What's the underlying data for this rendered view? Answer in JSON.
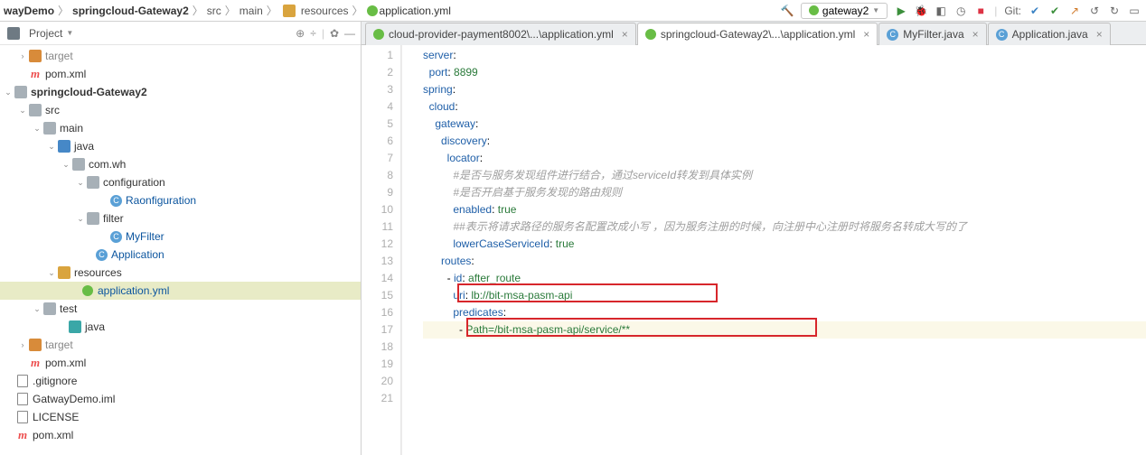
{
  "breadcrumbs": {
    "p0": "wayDemo",
    "p1": "springcloud-Gateway2",
    "p2": "src",
    "p3": "main",
    "p4": "resources",
    "p5": "application.yml"
  },
  "runConfig": "gateway2",
  "gitLabel": "Git:",
  "sidebar": {
    "title": "Project",
    "nodes": [
      {
        "pad": 20,
        "arrow": ">",
        "ico": "folder orange",
        "label": "target",
        "dim": true
      },
      {
        "pad": 20,
        "arrow": "",
        "ico": "m",
        "label": "pom.xml"
      },
      {
        "pad": 4,
        "arrow": "v",
        "ico": "folder",
        "label": "springcloud-Gateway2",
        "bold": true
      },
      {
        "pad": 20,
        "arrow": "v",
        "ico": "folder",
        "label": "src"
      },
      {
        "pad": 36,
        "arrow": "v",
        "ico": "folder",
        "label": "main"
      },
      {
        "pad": 52,
        "arrow": "v",
        "ico": "folder blue",
        "label": "java"
      },
      {
        "pad": 68,
        "arrow": "v",
        "ico": "folder",
        "label": "com.wh"
      },
      {
        "pad": 84,
        "arrow": "v",
        "ico": "folder",
        "label": "configuration"
      },
      {
        "pad": 110,
        "arrow": "",
        "ico": "c",
        "label": "Raonfiguration",
        "blue": true
      },
      {
        "pad": 84,
        "arrow": "v",
        "ico": "folder",
        "label": "filter"
      },
      {
        "pad": 110,
        "arrow": "",
        "ico": "c",
        "label": "MyFilter",
        "blue": true
      },
      {
        "pad": 94,
        "arrow": "",
        "ico": "c",
        "label": "Application",
        "blue": true
      },
      {
        "pad": 52,
        "arrow": "v",
        "ico": "folder yellow",
        "label": "resources"
      },
      {
        "pad": 78,
        "arrow": "",
        "ico": "spring",
        "label": "application.yml",
        "blue": true,
        "hl": true
      },
      {
        "pad": 36,
        "arrow": "v",
        "ico": "folder",
        "label": "test"
      },
      {
        "pad": 64,
        "arrow": "",
        "ico": "folder teal",
        "label": "java"
      },
      {
        "pad": 20,
        "arrow": ">",
        "ico": "folder orange",
        "label": "target",
        "dim": true
      },
      {
        "pad": 20,
        "arrow": "",
        "ico": "m",
        "label": "pom.xml"
      },
      {
        "pad": 6,
        "arrow": "",
        "ico": "file",
        "label": ".gitignore"
      },
      {
        "pad": 6,
        "arrow": "",
        "ico": "file",
        "label": "GatwayDemo.iml"
      },
      {
        "pad": 6,
        "arrow": "",
        "ico": "file",
        "label": "LICENSE"
      },
      {
        "pad": 6,
        "arrow": "",
        "ico": "m",
        "label": "pom.xml"
      }
    ]
  },
  "tabs": [
    {
      "ico": "spring",
      "label": "cloud-provider-payment8002\\...\\application.yml",
      "active": false
    },
    {
      "ico": "spring",
      "label": "springcloud-Gateway2\\...\\application.yml",
      "active": true
    },
    {
      "ico": "c",
      "label": "MyFilter.java",
      "active": false
    },
    {
      "ico": "c",
      "label": "Application.java",
      "active": false
    }
  ],
  "code": {
    "lines": [
      {
        "n": 1,
        "ind": 0,
        "key": "server",
        "colon": ":"
      },
      {
        "n": 2,
        "ind": 1,
        "key": "port",
        "colon": ": ",
        "val": "8899"
      },
      {
        "n": 3,
        "ind": 0,
        "key": "spring",
        "colon": ":"
      },
      {
        "n": 4,
        "ind": 1,
        "key": "cloud",
        "colon": ":"
      },
      {
        "n": 5,
        "ind": 2,
        "key": "gateway",
        "colon": ":"
      },
      {
        "n": 6,
        "ind": 3,
        "key": "discovery",
        "colon": ":"
      },
      {
        "n": 7,
        "ind": 4,
        "key": "locator",
        "colon": ":"
      },
      {
        "n": 8,
        "ind": 5,
        "comment": "#是否与服务发现组件进行结合，通过serviceId转发到具体实例"
      },
      {
        "n": 9,
        "ind": 5,
        "comment": "#是否开启基于服务发现的路由规则"
      },
      {
        "n": 10,
        "ind": 5,
        "key": "enabled",
        "colon": ": ",
        "val": "true"
      },
      {
        "n": 11,
        "ind": 5,
        "comment": "##表示将请求路径的服务名配置改成小写 ，因为服务注册的时候，向注册中心注册时将服务名转成大写的了"
      },
      {
        "n": 12,
        "ind": 5,
        "key": "lowerCaseServiceId",
        "colon": ": ",
        "val": "true"
      },
      {
        "n": 13,
        "ind": 3,
        "key": "routes",
        "colon": ":"
      },
      {
        "n": 14,
        "ind": 4,
        "dash": "- ",
        "key": "id",
        "colon": ": ",
        "val": "after_route"
      },
      {
        "n": 15,
        "ind": 5,
        "key": "uri",
        "colon": ": ",
        "val": "lb://bit-msa-pasm-api"
      },
      {
        "n": 16,
        "ind": 5,
        "key": "predicates",
        "colon": ":"
      },
      {
        "n": 17,
        "ind": 6,
        "dash": "- ",
        "valOnly": "Path=/bit-msa-pasm-api/service/**",
        "hl": true
      },
      {
        "n": 18,
        "ind": 0
      },
      {
        "n": 19,
        "ind": 0
      },
      {
        "n": 20,
        "ind": 0
      },
      {
        "n": 21,
        "ind": 0
      }
    ]
  }
}
